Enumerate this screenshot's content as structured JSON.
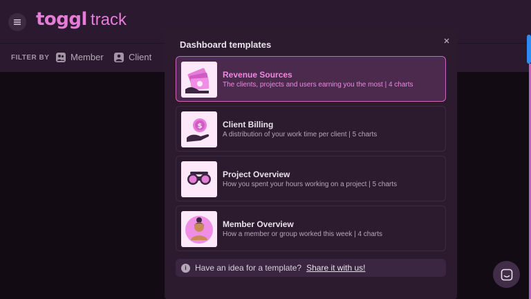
{
  "header": {
    "logo_word": "toggl",
    "logo_sub": "track"
  },
  "filter": {
    "label": "FILTER BY",
    "items": [
      {
        "label": "Member",
        "icon": "member-icon"
      },
      {
        "label": "Client",
        "icon": "client-icon"
      }
    ]
  },
  "modal": {
    "title": "Dashboard templates",
    "close_icon": "close-icon",
    "templates": [
      {
        "title": "Revenue Sources",
        "description": "The clients, projects and users earning you the most | 4 charts",
        "icon": "money-stack-illustration",
        "selected": true
      },
      {
        "title": "Client Billing",
        "description": "A distribution of your work time per client | 5 charts",
        "icon": "coin-in-hand-illustration",
        "selected": false
      },
      {
        "title": "Project Overview",
        "description": "How you spent your hours working on a project | 5 charts",
        "icon": "binoculars-illustration",
        "selected": false
      },
      {
        "title": "Member Overview",
        "description": "How a member or group worked this week | 4 charts",
        "icon": "person-avatar-illustration",
        "selected": false
      }
    ],
    "idea_text": "Have an idea for a template?",
    "idea_link": "Share it with us!"
  },
  "colors": {
    "accent": "#e57cd8",
    "selected_border": "#c868bd",
    "scroll_accent": "#2f8bf0"
  }
}
